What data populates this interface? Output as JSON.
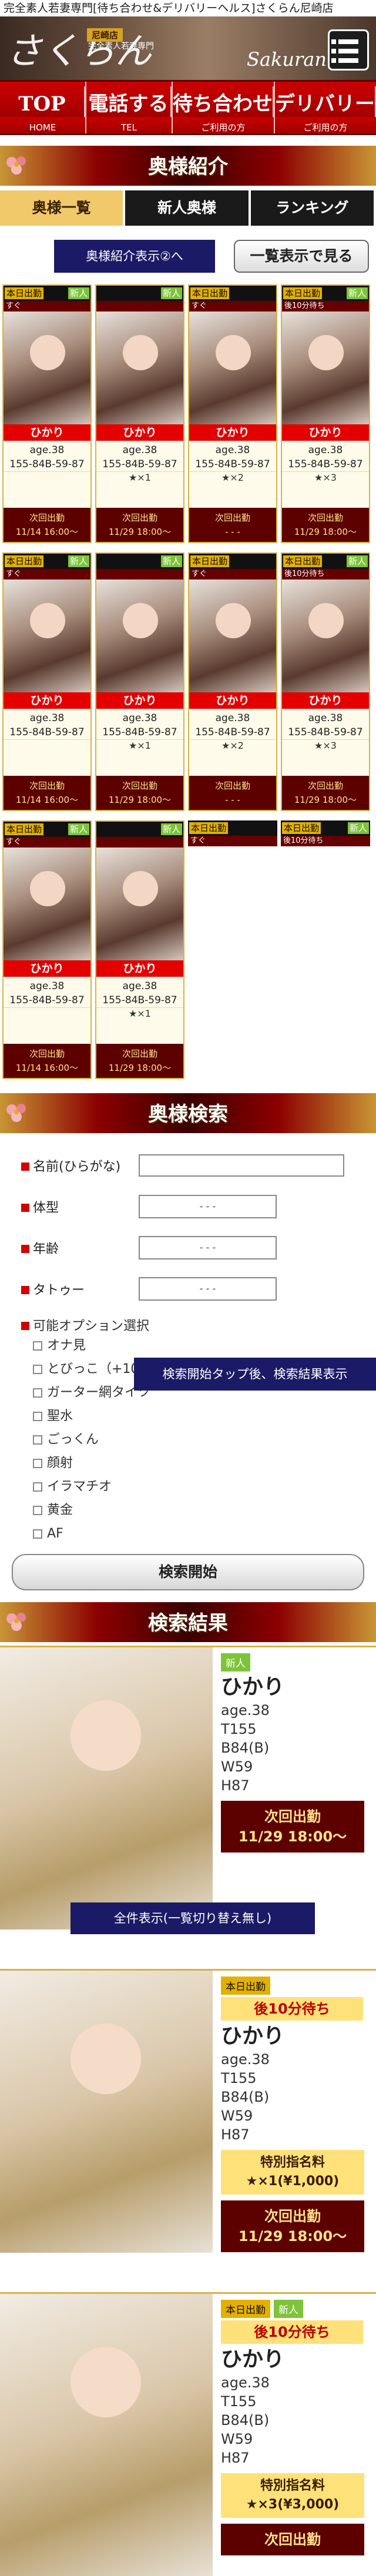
{
  "header": {
    "topline": "完全素人若妻専門[待ち合わせ&デリバリーヘルス]さくらん尼崎店",
    "brand": "さくらん",
    "shop": "尼崎店",
    "tag": "完全素人若妻専門",
    "brand2": "Sakuran"
  },
  "nav": [
    {
      "big": "TOP",
      "small": "HOME"
    },
    {
      "big": "電話する",
      "small": "TEL"
    },
    {
      "big": "待ち合わせ",
      "small": "ご利用の方"
    },
    {
      "big": "デリバリー",
      "small": "ご利用の方"
    }
  ],
  "section1": {
    "title": "奥様紹介"
  },
  "tabs": [
    "奥様一覧",
    "新人奥様",
    "ランキング"
  ],
  "sort": {
    "alt": "奥様紹介表示②へ",
    "list": "一覧表示で見る"
  },
  "cards": [
    {
      "b1": "本日出勤",
      "b2": "新人",
      "wait": "すぐ",
      "name": "ひかり",
      "age": "age.38",
      "size": "155-84B-59-87",
      "star": "",
      "nx1": "次回出勤",
      "nx2": "11/14 16:00～"
    },
    {
      "b1": "",
      "b2": "新人",
      "wait": "",
      "name": "ひかり",
      "age": "age.38",
      "size": "155-84B-59-87",
      "star": "★×1",
      "nx1": "次回出勤",
      "nx2": "11/29 18:00～"
    },
    {
      "b1": "本日出勤",
      "b2": "",
      "wait": "すぐ",
      "name": "ひかり",
      "age": "age.38",
      "size": "155-84B-59-87",
      "star": "★×2",
      "nx1": "次回出勤",
      "nx2": "- - -"
    },
    {
      "b1": "本日出勤",
      "b2": "新人",
      "wait": "後10分待ち",
      "name": "ひかり",
      "age": "age.38",
      "size": "155-84B-59-87",
      "star": "★×3",
      "nx1": "次回出勤",
      "nx2": "11/29 18:00～"
    },
    {
      "b1": "本日出勤",
      "b2": "新人",
      "wait": "すぐ",
      "name": "ひかり",
      "age": "age.38",
      "size": "155-84B-59-87",
      "star": "",
      "nx1": "次回出勤",
      "nx2": "11/14 16:00～"
    },
    {
      "b1": "",
      "b2": "新人",
      "wait": "",
      "name": "ひかり",
      "age": "age.38",
      "size": "155-84B-59-87",
      "star": "★×1",
      "nx1": "次回出勤",
      "nx2": "11/29 18:00～"
    },
    {
      "b1": "本日出勤",
      "b2": "",
      "wait": "すぐ",
      "name": "ひかり",
      "age": "age.38",
      "size": "155-84B-59-87",
      "star": "★×2",
      "nx1": "次回出勤",
      "nx2": "- - -"
    },
    {
      "b1": "本日出勤",
      "b2": "新人",
      "wait": "後10分待ち",
      "name": "ひかり",
      "age": "age.38",
      "size": "155-84B-59-87",
      "star": "★×3",
      "nx1": "次回出勤",
      "nx2": "11/29 18:00～"
    },
    {
      "b1": "本日出勤",
      "b2": "新人",
      "wait": "すぐ",
      "name": "ひかり",
      "age": "age.38",
      "size": "155-84B-59-87",
      "star": "",
      "nx1": "次回出勤",
      "nx2": "11/14 16:00～"
    },
    {
      "b1": "",
      "b2": "新人",
      "wait": "",
      "name": "ひかり",
      "age": "age.38",
      "size": "155-84B-59-87",
      "star": "★×1",
      "nx1": "次回出勤",
      "nx2": "11/29 18:00～"
    }
  ],
  "cards_extra_header": [
    {
      "b1": "本日出勤",
      "b2": "",
      "wait": "すぐ"
    },
    {
      "b1": "本日出勤",
      "b2": "新人",
      "wait": "後10分待ち"
    }
  ],
  "section2": {
    "title": "奥様検索"
  },
  "search": {
    "name_label": "名前(ひらがな)",
    "body_label": "体型",
    "age_label": "年齢",
    "tattoo_label": "タトゥー",
    "select_placeholder": "- - -",
    "option_label": "可能オプション選択",
    "options": [
      "オナ見",
      "とびっこ（+10分）",
      "ガーター網タイツ",
      "聖水",
      "ごっくん",
      "顔射",
      "イラマチオ",
      "黄金",
      "AF"
    ],
    "tip": "検索開始タップ後、検索結果表示",
    "submit": "検索開始"
  },
  "section3": {
    "title": "検索結果"
  },
  "results": [
    {
      "b1": "",
      "b2": "新人",
      "wait": "",
      "name": "ひかり",
      "d1": "age.38",
      "d2": "T155",
      "d3": "B84(B)",
      "d4": "W59",
      "d5": "H87",
      "nom": "",
      "next1": "次回出勤",
      "next2": "11/29 18:00～"
    },
    {
      "b1": "本日出勤",
      "b2": "",
      "wait": "後10分待ち",
      "name": "ひかり",
      "d1": "age.38",
      "d2": "T155",
      "d3": "B84(B)",
      "d4": "W59",
      "d5": "H87",
      "nom1": "特別指名料",
      "nom2": "★×1(¥1,000)",
      "next1": "次回出勤",
      "next2": "11/29 18:00～"
    },
    {
      "b1": "本日出勤",
      "b2": "新人",
      "wait": "後10分待ち",
      "name": "ひかり",
      "d1": "age.38",
      "d2": "T155",
      "d3": "B84(B)",
      "d4": "W59",
      "d5": "H87",
      "nom1": "特別指名料",
      "nom2": "★×3(¥3,000)",
      "next1": "次回出勤",
      "next2": ""
    }
  ],
  "all_button": "全件表示(一覧切り替え無し)",
  "colors": {
    "accent_red": "#c80000",
    "gold": "#d7b348",
    "navy": "#1a1a66"
  }
}
